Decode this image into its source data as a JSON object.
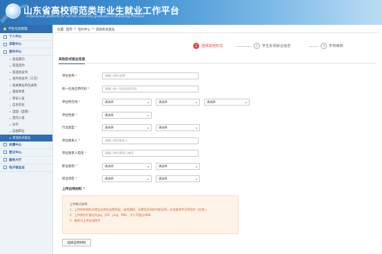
{
  "header": {
    "title": "山东省高校师范类毕业生就业工作平台",
    "subtitle": "Employment platform for normal university graduates in Shandong Province"
  },
  "sidebar": {
    "top_label": "学生信息管理",
    "groups": [
      {
        "label": "个人中心"
      },
      {
        "label": "求职中心"
      },
      {
        "label": "签约中心"
      }
    ],
    "items": [
      {
        "label": "双选意向"
      },
      {
        "label": "双选签约"
      },
      {
        "label": "双选协议书"
      },
      {
        "label": "省外协议书（三方）"
      },
      {
        "label": "机关事业单位录用"
      },
      {
        "label": "基层项目"
      },
      {
        "label": "参军入伍"
      },
      {
        "label": "自主创业"
      },
      {
        "label": "出国（出境）"
      },
      {
        "label": "定向入伍"
      },
      {
        "label": "升学"
      },
      {
        "label": "自由职业"
      },
      {
        "label": "其他形式就业"
      }
    ],
    "bottom_groups": [
      {
        "label": "派遣中心"
      },
      {
        "label": "登记中心"
      },
      {
        "label": "服务大厅"
      },
      {
        "label": "电子就业证"
      }
    ]
  },
  "breadcrumb": {
    "prefix": "位置:",
    "home": "首页",
    "sep": ">",
    "level1": "签约中心",
    "level2": "其他形式就业"
  },
  "steps": [
    {
      "num": "1",
      "label": "选择其他形式"
    },
    {
      "num": "2",
      "label": "学生反馈就业信息"
    },
    {
      "num": "3",
      "label": "学校审核"
    }
  ],
  "section_title": "其他形式就业信息",
  "form": {
    "unit_name": {
      "label": "单位名称",
      "placeholder": "请输入单位名称"
    },
    "credit_code": {
      "label": "统一社会信用代码",
      "placeholder": "请输入统一社会信用代码"
    },
    "unit_location": {
      "label": "单位所在地",
      "sel1": "请选择",
      "sel2": "请选择",
      "sel3": "请选择"
    },
    "unit_nature": {
      "label": "单位性质",
      "sel1": "请选择"
    },
    "industry": {
      "label": "行业类型",
      "sel1": "请选择",
      "sel2": "请选择"
    },
    "contact": {
      "label": "单位联系人",
      "placeholder": "请输入单位联系人"
    },
    "phone": {
      "label": "单位联系人电话",
      "placeholder": "请输入单位联系人电话"
    },
    "job_category": {
      "label": "职业类别",
      "sel1": "请选择",
      "sel2": "请选择"
    },
    "work_place": {
      "label": "就业地区",
      "sel1": "请选择",
      "sel2": "请选择"
    }
  },
  "upload": {
    "title": "上传证明材料",
    "tip_head": "上传格式说明：",
    "tips": [
      "1、上传的其他形式就业证明包括聘用函、录用通知、无需签合同的书面证明，必须盖章并注明签约（红章）。",
      "2、上传照片扩展名为jpg、JPG、png、PNG，大小不超过4MB",
      "3、最多可上传五张照片"
    ],
    "button": "选择证明材料"
  }
}
